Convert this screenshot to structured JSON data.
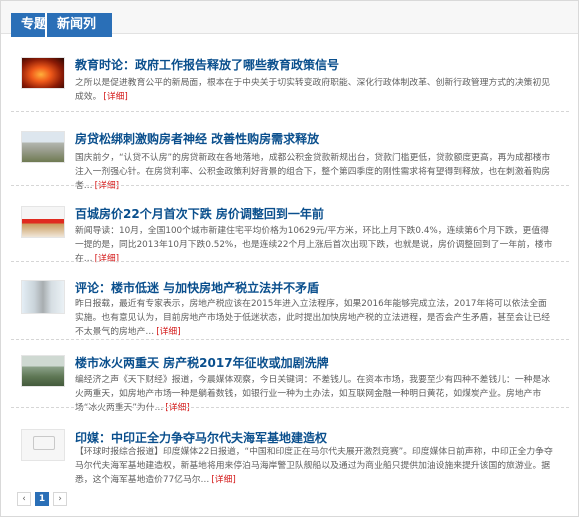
{
  "tabs": [
    {
      "label": "专题"
    },
    {
      "label": "新闻列表"
    }
  ],
  "items": [
    {
      "title": "教育时论：政府工作报告释放了哪些教育政策信号",
      "desc": "之所以是促进教育公平的新局面，根本在于中央关于切实转变政府职能、深化行政体制改革、创新行政管理方式的决策初见成效。",
      "more": "[详细]"
    },
    {
      "title": "房贷松绑刺激购房者神经 改善性购房需求释放",
      "desc": "国庆前夕，“认贷不认房”的房贷新政在各地落地，成都公积金贷款新规出台，贷款门槛更低，贷款额度更高，再为成都楼市注入一剂强心针。在房贷利率、公积金政策利好背景的组合下，整个第四季度的刚性需求将有望得到释放，也在刺激着购房者…",
      "more": "[详细]"
    },
    {
      "title": "百城房价22个月首次下跌 房价调整回到一年前",
      "desc": "新闻导读：10月，全国100个城市新建住宅平均价格为10629元/平方米，环比上月下跌0.4%，连续第6个月下跌，更值得一提的是，同比2013年10月下跌0.52%，也是连续22个月上涨后首次出现下跌，也就是说，房价调整回到了一年前，楼市在…",
      "more": "[详细]"
    },
    {
      "title": "评论：楼市低迷 与加快房地产税立法并不矛盾",
      "desc": "昨日报载，最近有专家表示，房地产税应该在2015年进入立法程序，如果2016年能够完成立法，2017年将可以依法全面实施。也有意见认为，目前房地产市场处于低迷状态，此时提出加快房地产税的立法进程，是否会产生矛盾，甚至会让已经不太景气的房地产…",
      "more": "[详细]"
    },
    {
      "title": "楼市冰火两重天 房产税2017年征收或加剧洗牌",
      "desc": "编经济之声《天下财经》报道，今晨媒体观察，今日关键词：不差钱儿。在资本市场，我要至少有四种不差钱儿：一种是冰火两重天，如房地产市场一种是躺着数钱，如银行业一种为土办法，如互联网金融一种明日黄花，如煤炭产业。房地产市场“冰火两重天”为什…",
      "more": "[详细]"
    },
    {
      "title": "印媒：中印正全力争夺马尔代夫海军基地建造权",
      "desc": "【环球时报综合报道】印度媒体22日报道，“中国和印度正在马尔代夫展开激烈竞赛”。印度媒体日前声称，中印正全力争夺马尔代夫海军基地建造权，新基地将用来停泊马海岸警卫队舰船以及通过为商业船只提供加油设施来提升该国的旅游业。据悉，这个海军基地造价77亿马尔…",
      "more": "[详细]"
    }
  ],
  "pager": {
    "prev": "‹",
    "page": "1",
    "next": "›"
  }
}
